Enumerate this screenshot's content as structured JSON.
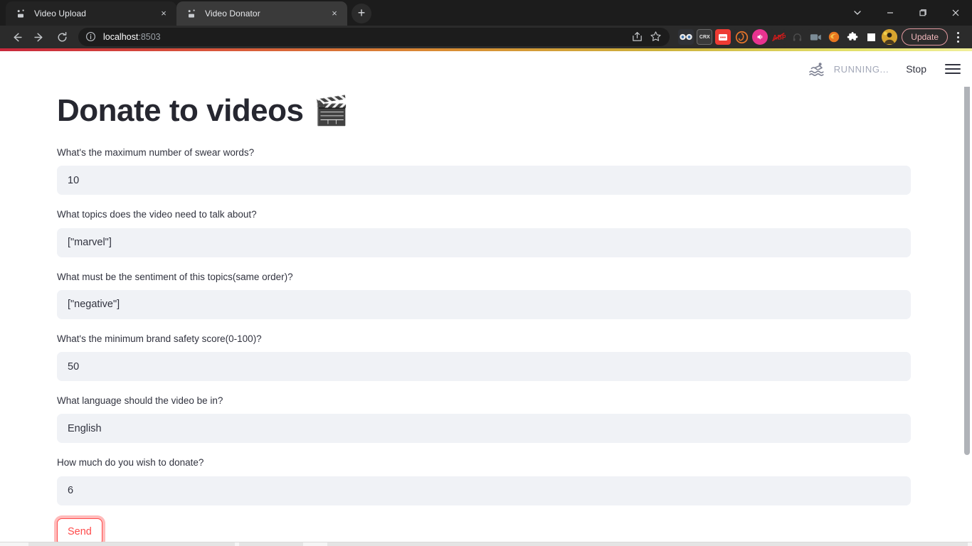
{
  "browser": {
    "tabs": [
      {
        "title": "Video Upload",
        "favicon": "streamlit-favicon",
        "active": false,
        "close_label": "×"
      },
      {
        "title": "Video Donator",
        "favicon": "streamlit-favicon",
        "active": true,
        "close_label": "×"
      }
    ],
    "new_tab_label": "+",
    "window_controls": {
      "tab_search": "tab-search-chevron",
      "minimize": "minimize",
      "maximize": "maximize",
      "close": "close"
    },
    "toolbar": {
      "back": "back-arrow",
      "forward": "forward-arrow",
      "reload": "reload",
      "site_info": "site-info",
      "url_main": "localhost",
      "url_suffix": ":8503",
      "share": "share-icon",
      "bookmark": "star-icon",
      "update_label": "Update",
      "menu": "kebab-menu",
      "extensions": [
        {
          "name": "glasses-extension",
          "color": "#2f3136"
        },
        {
          "name": "crx-extension",
          "color": "#3a3a3a",
          "text": "CRX"
        },
        {
          "name": "red-video-extension",
          "color": "#ee3b33"
        },
        {
          "name": "orange-ring-extension",
          "color": "#2f2f2f"
        },
        {
          "name": "pink-speaker-extension",
          "color": "#e8338f"
        },
        {
          "name": "abp-extension",
          "color": "#d11b1b",
          "text": "ABP"
        },
        {
          "name": "dark-extension",
          "color": "#3b3b3b"
        },
        {
          "name": "video-download-extension",
          "color": "#3b4a56"
        },
        {
          "name": "firefox-extension",
          "color": "#e8761f"
        },
        {
          "name": "puzzle-extensions-icon",
          "color": "#ffffff"
        },
        {
          "name": "square-extension",
          "color": "#ffffff"
        },
        {
          "name": "profile-avatar",
          "color": "#e2b23a"
        }
      ]
    },
    "theme_accent": "#c8283c"
  },
  "streamlit": {
    "status_text": "RUNNING...",
    "status_icon": "swimmer-icon",
    "stop_label": "Stop",
    "menu_icon": "hamburger-menu-icon",
    "title": "Donate to videos",
    "title_emoji": "🎬",
    "accent_color": "#ff4b4b",
    "input_bg": "#f0f2f6",
    "fields": [
      {
        "label": "What's the maximum number of swear words?",
        "value": "10",
        "name": "max-swear-words"
      },
      {
        "label": "What topics does the video need to talk about?",
        "value": "[\"marvel\"]",
        "name": "topics"
      },
      {
        "label": "What must be the sentiment of this topics(same order)?",
        "value": "[\"negative\"]",
        "name": "sentiment"
      },
      {
        "label": "What's the minimum brand safety score(0-100)?",
        "value": "50",
        "name": "brand-safety-score"
      },
      {
        "label": "What language should the video be in?",
        "value": "English",
        "name": "language"
      },
      {
        "label": "How much do you wish to donate?",
        "value": "6",
        "name": "donation-amount"
      }
    ],
    "submit_label": "Send"
  }
}
